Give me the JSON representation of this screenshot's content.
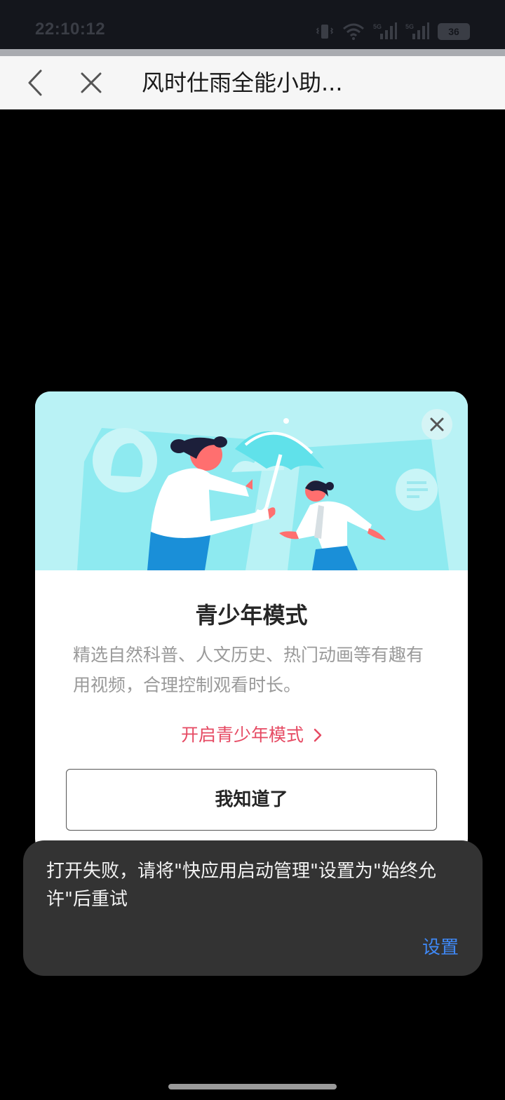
{
  "status_bar": {
    "time": "22:10:12",
    "network_1": "5G",
    "network_2": "5G",
    "battery": "36",
    "icons": [
      "vibrate-icon",
      "wifi-icon",
      "signal-5g-icon",
      "signal-5g-icon",
      "battery-icon"
    ]
  },
  "nav": {
    "title": "风时仕雨全能小助...",
    "back_icon": "chevron-left-icon",
    "close_icon": "close-icon"
  },
  "dialog": {
    "title": "青少年模式",
    "description": "精选自然科普、人文历史、热门动画等有趣有用视频，合理控制观看时长。",
    "enable_link": "开启青少年模式",
    "confirm_button": "我知道了",
    "close_icon": "close-icon",
    "illustration": "person-holding-umbrella-over-child-illustration",
    "colors": {
      "hero_bg": "#b9f2f5",
      "accent_link": "#e64a63"
    }
  },
  "toast": {
    "message": "打开失败，请将\"快应用启动管理\"设置为\"始终允许\"后重试",
    "action": "设置",
    "colors": {
      "bg": "#333333",
      "action": "#3f88f5"
    }
  }
}
